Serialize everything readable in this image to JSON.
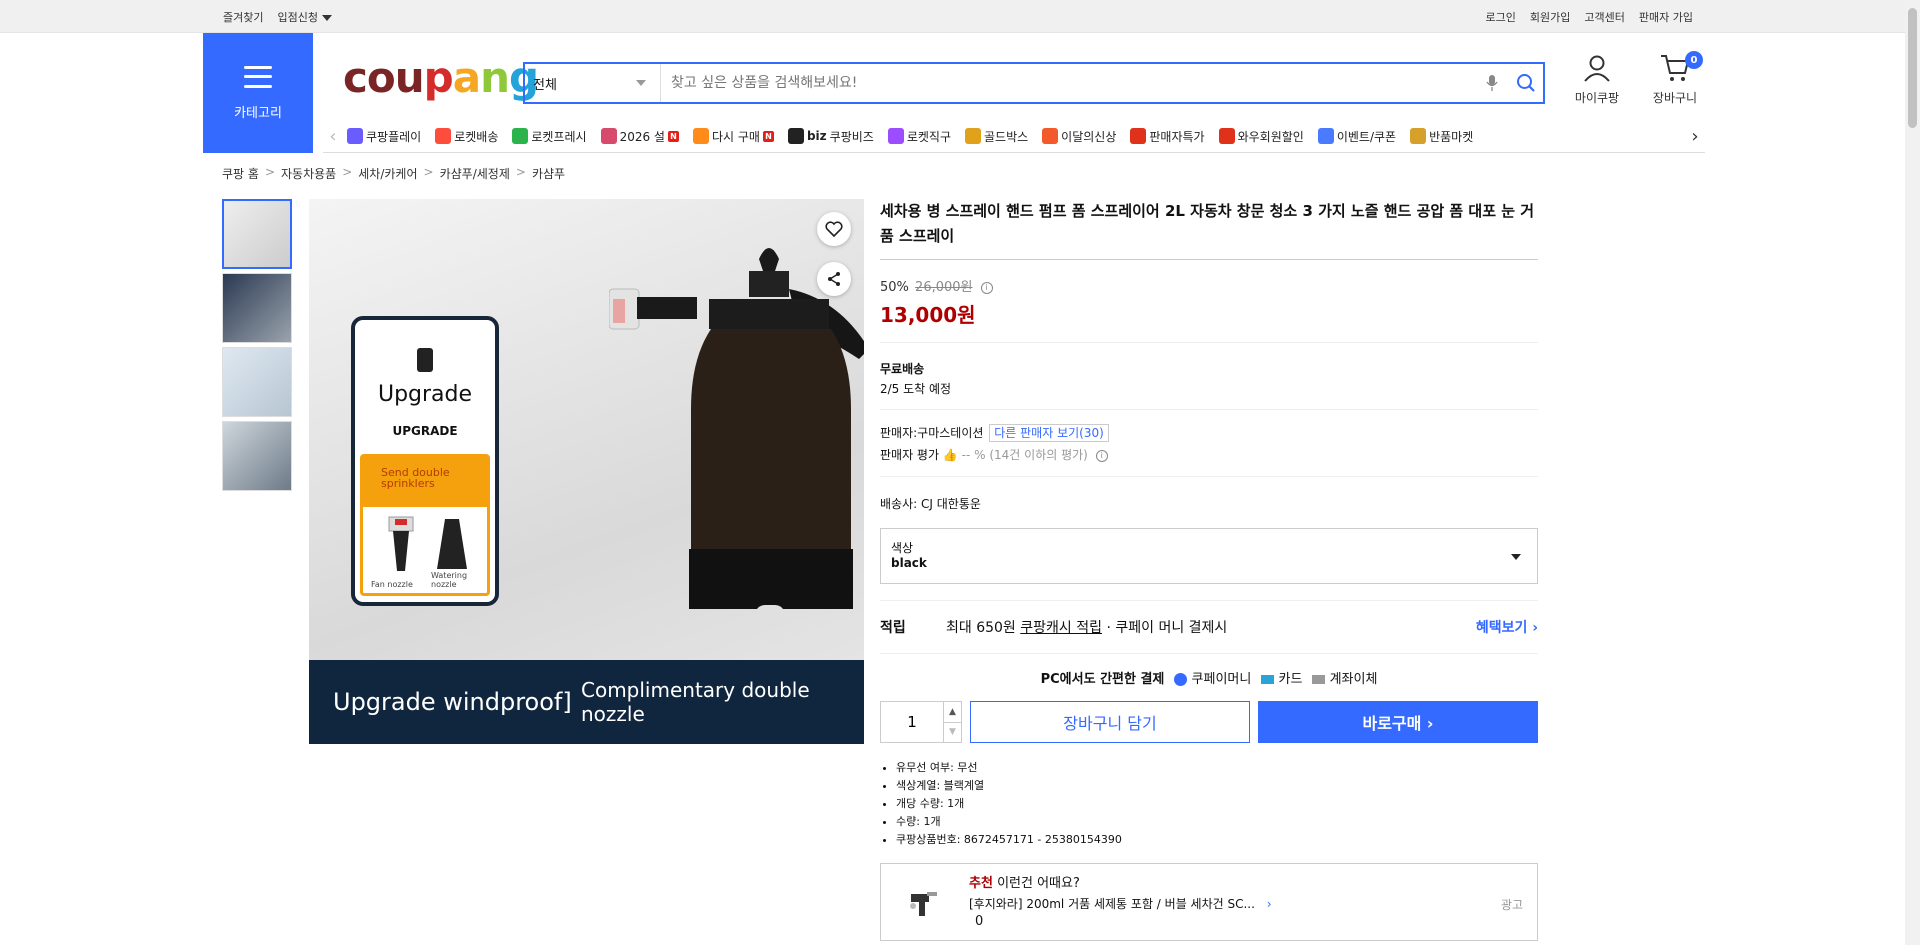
{
  "topbar": {
    "left": [
      "즐겨찾기",
      "입점신청"
    ],
    "right": [
      "로그인",
      "회원가입",
      "고객센터",
      "판매자 가입"
    ]
  },
  "header": {
    "category_label": "카테고리",
    "logo": [
      "cou",
      "p",
      "a",
      "n",
      "g"
    ],
    "search_scope": "전체",
    "search_placeholder": "찾고 싶은 상품을 검색해보세요!",
    "mycoupang_label": "마이쿠팡",
    "cart_label": "장바구니",
    "cart_count": "0"
  },
  "nav": {
    "items": [
      {
        "label": "쿠팡플레이",
        "icon": "play-icon",
        "color": "#6a5cff"
      },
      {
        "label": "로켓배송",
        "icon": "rocket-icon",
        "color": "#ff4d3d"
      },
      {
        "label": "로켓프레시",
        "icon": "fresh-rocket-icon",
        "color": "#2bb44b"
      },
      {
        "label": "2026 설",
        "icon": "new-year-icon",
        "color": "#d64a6b",
        "new": "N"
      },
      {
        "label": "다시 구매",
        "icon": "rebuy-icon",
        "color": "#ff8c1a",
        "new": "N"
      },
      {
        "label": "쿠팡비즈",
        "icon": "biz-icon",
        "color": "#222222",
        "prefix": "biz"
      },
      {
        "label": "로켓직구",
        "icon": "global-icon",
        "color": "#9b4dff"
      },
      {
        "label": "골드박스",
        "icon": "goldbox-icon",
        "color": "#e0a21b"
      },
      {
        "label": "이달의신상",
        "icon": "new-arrival-icon",
        "color": "#f25a2c"
      },
      {
        "label": "판매자특가",
        "icon": "seller-deal-icon",
        "color": "#e0321b"
      },
      {
        "label": "와우회원할인",
        "icon": "wow-icon",
        "color": "#e0321b"
      },
      {
        "label": "이벤트/쿠폰",
        "icon": "coupon-icon",
        "color": "#4a7bff"
      },
      {
        "label": "반품마켓",
        "icon": "return-market-icon",
        "color": "#d6a12a"
      }
    ]
  },
  "breadcrumb": [
    "쿠팡 홈",
    "자동차용품",
    "세차/카케어",
    "카샴푸/세정제",
    "카샴푸"
  ],
  "gallery": {
    "card_upgrade_title": "Upgrade",
    "card_upgrade_sub": "UPGRADE",
    "card_offer": "Send double sprinklers",
    "nozzle_a": "Fan nozzle",
    "nozzle_b": "Watering nozzle",
    "banner_left": "Upgrade windproof]",
    "banner_right": "Complimentary double nozzle",
    "thumb_count": 4
  },
  "product": {
    "title": "세차용 병 스프레이 핸드 펌프 폼 스프레이어 2L 자동차 창문 청소 3 가지 노즐 핸드 공압 폼 대포 눈 거품 스프레이",
    "discount_rate": "50%",
    "original_price": "26,000원",
    "sale_price": "13,000원",
    "shipping_title": "무료배송",
    "arrival": "2/5 도착 예정",
    "seller_label": "판매자:",
    "seller_name": "구마스테이션",
    "other_sellers": "다른 판매자 보기(30)",
    "seller_rating_label": "판매자 평가",
    "seller_rating_value": "-- %",
    "seller_rating_note": "(14건 이하의 평가)",
    "carrier_label": "배송사:",
    "carrier_name": "CJ 대한통운",
    "option_label": "색상",
    "option_value": "black",
    "reward_label": "적립",
    "reward_text_a": "최대 650원",
    "reward_link": "쿠팡캐시 적립",
    "reward_text_b": "· 쿠페이 머니 결제시",
    "reward_more": "혜택보기",
    "pay_title": "PC에서도 간편한 결제",
    "pay_methods": [
      "쿠페이머니",
      "카드",
      "계좌이체"
    ],
    "quantity": "1",
    "cart_button": "장바구니 담기",
    "buy_button": "바로구매",
    "attributes": [
      "유무선 여부: 무선",
      "색상계열: 블랙계열",
      "개당 수량: 1개",
      "수량: 1개",
      "쿠팡상품번호: 8672457171 - 25380154390"
    ]
  },
  "recommend": {
    "tag": "추천",
    "heading": "이런건 어때요?",
    "item": "[후지와라] 200ml 거품 세제통 포함 / 버블 세차건 SC...",
    "price": "0",
    "ad": "광고"
  },
  "colors": {
    "accent": "#346aff",
    "price": "#ae0000"
  }
}
